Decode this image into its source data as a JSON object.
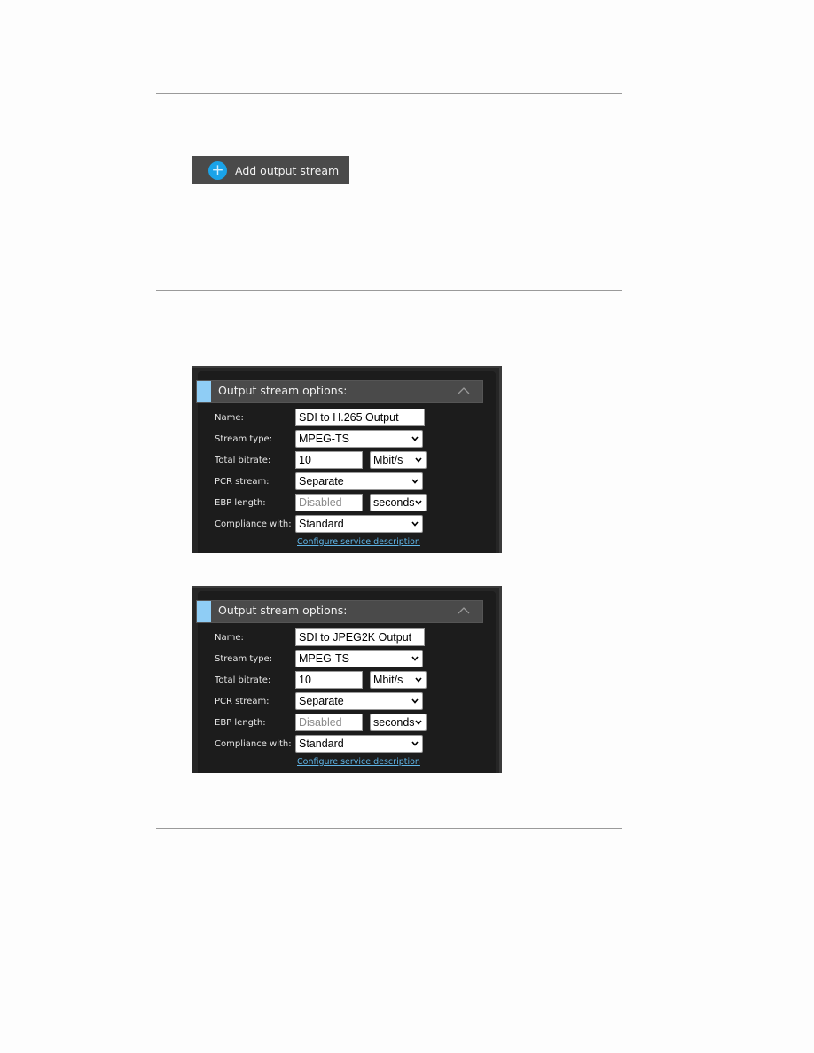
{
  "add_button": {
    "label": "Add output stream",
    "icon": "plus-circle-icon",
    "accent": "#1aa3e8"
  },
  "panels": [
    {
      "title": "Output stream options:",
      "fields": {
        "name_label": "Name:",
        "name_value": "SDI to H.265 Output",
        "stream_type_label": "Stream type:",
        "stream_type_value": "MPEG-TS",
        "bitrate_label": "Total bitrate:",
        "bitrate_value": "10",
        "bitrate_unit": "Mbit/s",
        "pcr_label": "PCR stream:",
        "pcr_value": "Separate",
        "ebp_label": "EBP length:",
        "ebp_placeholder": "Disabled",
        "ebp_unit": "seconds",
        "compliance_label": "Compliance with:",
        "compliance_value": "Standard"
      },
      "link": "Configure service description"
    },
    {
      "title": "Output stream options:",
      "fields": {
        "name_label": "Name:",
        "name_value": "SDI to JPEG2K Output",
        "stream_type_label": "Stream type:",
        "stream_type_value": "MPEG-TS",
        "bitrate_label": "Total bitrate:",
        "bitrate_value": "10",
        "bitrate_unit": "Mbit/s",
        "pcr_label": "PCR stream:",
        "pcr_value": "Separate",
        "ebp_label": "EBP length:",
        "ebp_placeholder": "Disabled",
        "ebp_unit": "seconds",
        "compliance_label": "Compliance with:",
        "compliance_value": "Standard"
      },
      "link": "Configure service description"
    }
  ],
  "colors": {
    "panel_accent": "#8fcdf5",
    "link": "#5fb4e6"
  }
}
